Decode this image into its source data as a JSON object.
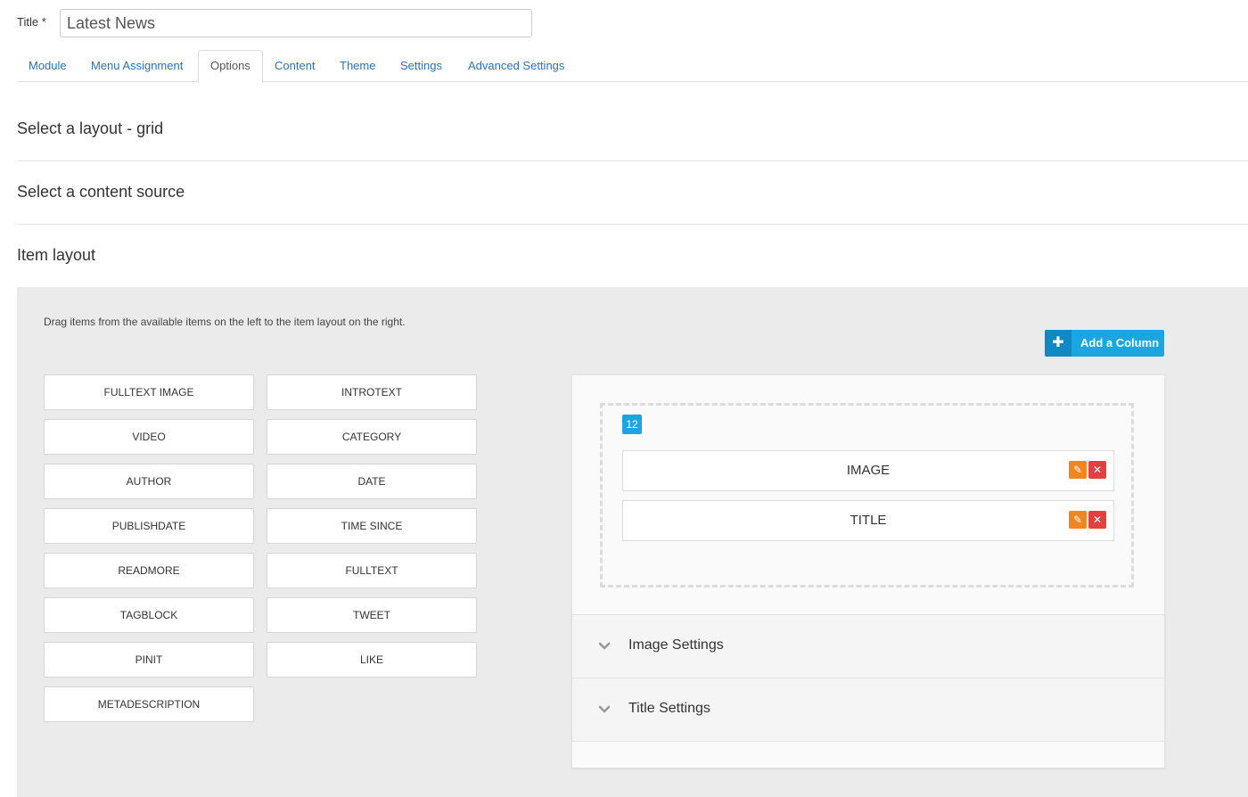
{
  "title_field": {
    "label": "Title *",
    "value": "Latest News"
  },
  "tabs": [
    {
      "label": "Module",
      "active": false
    },
    {
      "label": "Menu Assignment",
      "active": false
    },
    {
      "label": "Options",
      "active": true
    },
    {
      "label": "Content",
      "active": false
    },
    {
      "label": "Theme",
      "active": false
    },
    {
      "label": "Settings",
      "active": false
    },
    {
      "label": "Advanced Settings",
      "active": false
    }
  ],
  "sections": {
    "layout": "Select a layout - grid",
    "content_source": "Select a content source",
    "item_layout": "Item layout"
  },
  "item_layout_panel": {
    "hint": "Drag items from the available items on the left to the item layout on the right.",
    "add_column_label": "Add a Column",
    "available_items": [
      "FULLTEXT IMAGE",
      "INTROTEXT",
      "VIDEO",
      "CATEGORY",
      "AUTHOR",
      "DATE",
      "PUBLISHDATE",
      "TIME SINCE",
      "READMORE",
      "FULLTEXT",
      "TAGBLOCK",
      "TWEET",
      "PINIT",
      "LIKE",
      "METADESCRIPTION"
    ],
    "column": {
      "width_badge": "12",
      "items": [
        "IMAGE",
        "TITLE"
      ]
    },
    "settings_groups": [
      "Image Settings",
      "Title Settings"
    ]
  },
  "colors": {
    "accent_blue": "#1aa6e0",
    "edit_orange": "#f0861f",
    "remove_red": "#e54040",
    "link_blue": "#3071a9",
    "panel_bg": "#ebebeb"
  },
  "icons": {
    "add": "plus-icon",
    "edit": "pencil-icon",
    "remove": "close-icon",
    "expand": "chevron-down-icon"
  }
}
